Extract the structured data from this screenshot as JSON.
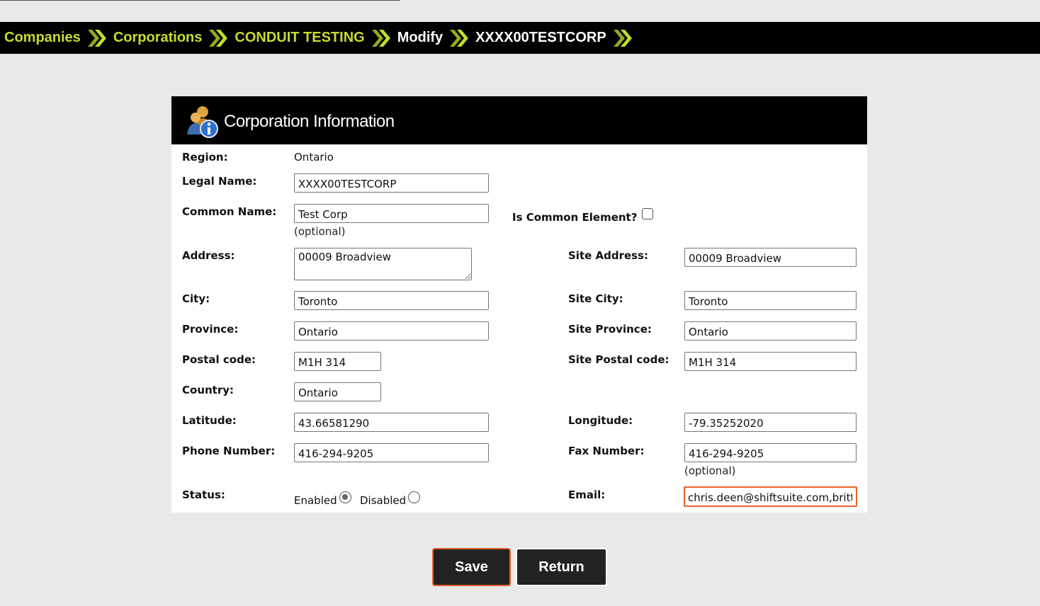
{
  "breadcrumb": {
    "items": [
      {
        "label": "Companies"
      },
      {
        "label": "Corporations"
      },
      {
        "label": "CONDUIT TESTING"
      },
      {
        "label": "Modify"
      },
      {
        "label": "XXXX00TESTCORP"
      }
    ]
  },
  "panel": {
    "title": "Corporation Information",
    "icon": "user-info-icon"
  },
  "form": {
    "region": {
      "label": "Region:",
      "value": "Ontario"
    },
    "legal_name": {
      "label": "Legal Name:",
      "value": "XXXX00TESTCORP"
    },
    "common_name": {
      "label": "Common Name:",
      "value": "Test Corp",
      "hint": "(optional)"
    },
    "is_common_element": {
      "label": "Is Common Element?",
      "checked": false
    },
    "address": {
      "label": "Address:",
      "value": "00009 Broadview"
    },
    "city": {
      "label": "City:",
      "value": "Toronto"
    },
    "province": {
      "label": "Province:",
      "value": "Ontario"
    },
    "postal_code": {
      "label": "Postal code:",
      "value": "M1H 314"
    },
    "country": {
      "label": "Country:",
      "value": "Ontario"
    },
    "latitude": {
      "label": "Latitude:",
      "value": "43.66581290"
    },
    "phone": {
      "label": "Phone Number:",
      "value": "416-294-9205"
    },
    "status": {
      "label": "Status:",
      "enabled_label": "Enabled",
      "disabled_label": "Disabled",
      "selected": "Enabled"
    },
    "site_address": {
      "label": "Site Address:",
      "value": "00009 Broadview"
    },
    "site_city": {
      "label": "Site City:",
      "value": "Toronto"
    },
    "site_province": {
      "label": "Site Province:",
      "value": "Ontario"
    },
    "site_postal_code": {
      "label": "Site Postal code:",
      "value": "M1H 314"
    },
    "longitude": {
      "label": "Longitude:",
      "value": "-79.35252020"
    },
    "fax": {
      "label": "Fax Number:",
      "value": "416-294-9205",
      "hint": "(optional)"
    },
    "email": {
      "label": "Email:",
      "value": "chris.deen@shiftsuite.com,brittney"
    }
  },
  "buttons": {
    "save": "Save",
    "return": "Return"
  },
  "colors": {
    "breadcrumb_link": "#c6dc2b",
    "focus_outline": "#e8602c",
    "header_bg": "#000000",
    "page_bg": "#e9e9e9"
  }
}
